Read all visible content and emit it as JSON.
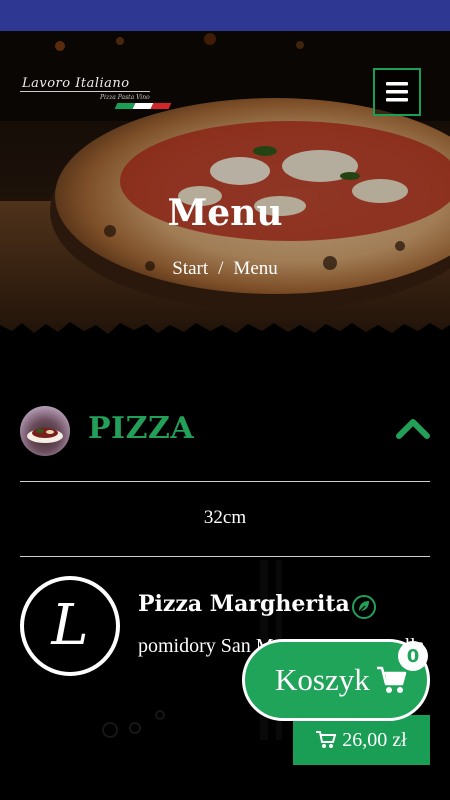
{
  "header": {
    "logo": {
      "name": "Lavoro Italiano",
      "tagline": "Pizza Pasta Vino"
    },
    "flag_colors": [
      "#1a9e55",
      "#ffffff",
      "#d1262c"
    ]
  },
  "hero": {
    "title": "Menu",
    "breadcrumb": [
      "Start",
      "/",
      "Menu"
    ]
  },
  "category": {
    "title": "PIZZA",
    "size": "32cm"
  },
  "item": {
    "logo_letter": "L",
    "name": "Pizza Margherita",
    "description": "pomidory San Marzano, mozzarella",
    "price": "26,00 zł",
    "badge_icon": "leaf-icon"
  },
  "basket": {
    "label": "Koszyk",
    "count": "0"
  },
  "colors": {
    "accent": "#22a05a",
    "status_bar": "#2e3792"
  }
}
